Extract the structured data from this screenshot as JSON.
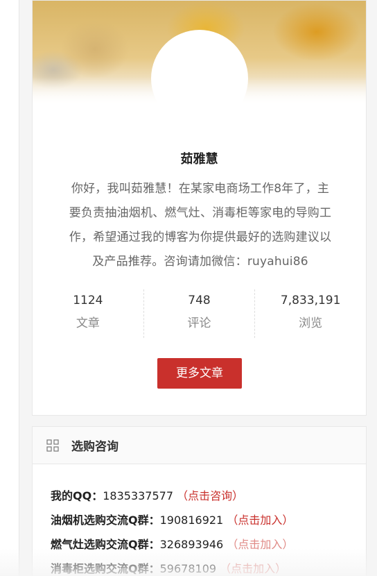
{
  "profile": {
    "name": "茹雅慧",
    "bio_lines": [
      "你好，我叫茹雅慧！在某家电商场工作8年了，主",
      "要负责抽油烟机、燃气灶、消毒柜等家电的导购工",
      "作，希望通过我的博客为你提供最好的选购建议以",
      "及产品推荐。咨询请加微信：ruyahui86"
    ],
    "stats": [
      {
        "value": "1124",
        "label": "文章"
      },
      {
        "value": "748",
        "label": "评论"
      },
      {
        "value": "7,833,191",
        "label": "浏览"
      }
    ],
    "more_button_label": "更多文章"
  },
  "consult": {
    "title": "选购咨询",
    "icon": "grid-icon",
    "rows": [
      {
        "label": "我的QQ：",
        "number": "1835337577",
        "link": "点击咨询"
      },
      {
        "label": "油烟机选购交流Q群：",
        "number": "190816921",
        "link": "点击加入"
      },
      {
        "label": "燃气灶选购交流Q群：",
        "number": "326893946",
        "link": "点击加入"
      },
      {
        "label": "消毒柜选购交流Q群：",
        "number": "59678109",
        "link": "点击加入"
      }
    ]
  },
  "colors": {
    "accent": "#c9302c",
    "text": "#222222",
    "muted": "#888888"
  }
}
